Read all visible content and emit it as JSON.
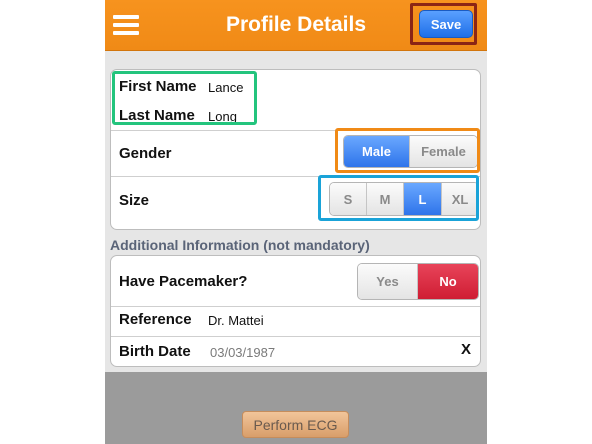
{
  "header": {
    "title": "Profile Details",
    "save_label": "Save",
    "menu_icon": "hamburger-icon"
  },
  "profile": {
    "first_name_label": "First Name",
    "first_name_value": "Lance",
    "last_name_label": "Last Name",
    "last_name_value": "Long",
    "gender_label": "Gender",
    "gender_options": [
      "Male",
      "Female"
    ],
    "gender_selected": "Male",
    "size_label": "Size",
    "size_options": [
      "S",
      "M",
      "L",
      "XL"
    ],
    "size_selected": "L"
  },
  "additional": {
    "heading": "Additional Information (not mandatory)",
    "pacemaker_label": "Have Pacemaker?",
    "pacemaker_options": [
      "Yes",
      "No"
    ],
    "pacemaker_selected": "No",
    "reference_label": "Reference",
    "reference_value": "Dr. Mattei",
    "birth_date_label": "Birth Date",
    "birth_date_value": "03/03/1987",
    "clear_label": "X"
  },
  "footer": {
    "ecg_button_label": "Perform ECG"
  },
  "colors": {
    "header_orange": "#f7931e",
    "selected_blue": "#2e74ea",
    "selected_red": "#cf1d33",
    "highlight_green": "#23c47d",
    "highlight_orange": "#f08a16",
    "highlight_cyan": "#1aa3d8",
    "highlight_darkred": "#8b2515"
  }
}
